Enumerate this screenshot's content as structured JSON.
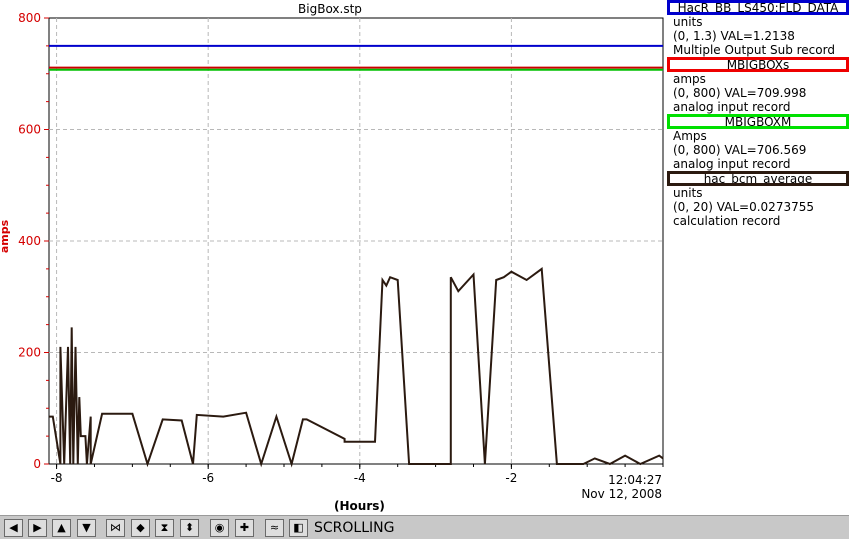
{
  "window": {
    "title": "BigBox.stp"
  },
  "chart_data": {
    "type": "line",
    "title": "BigBox.stp",
    "xlabel": "(Hours)",
    "ylabel": "amps",
    "xlim": [
      -8.1,
      0
    ],
    "ylim": [
      0,
      800
    ],
    "x_ticks": [
      -8,
      -6,
      -4,
      -2
    ],
    "y_ticks": [
      0,
      200,
      400,
      600,
      800
    ],
    "grid": true,
    "series": [
      {
        "name": "HacR_BB_LS450:FLD_DATA",
        "color": "#0000cc",
        "x": [
          -8.1,
          0
        ],
        "values": [
          750,
          750
        ]
      },
      {
        "name": "MBIGBOXs",
        "color": "#cc0000",
        "x": [
          -8.1,
          0
        ],
        "values": [
          711,
          711
        ]
      },
      {
        "name": "MBIGBOXM",
        "color": "#00c000",
        "x": [
          -8.1,
          0
        ],
        "values": [
          707,
          707
        ]
      },
      {
        "name": "hac_bcm_average",
        "color": "#2b1a10",
        "x": [
          -8.1,
          -8.05,
          -7.95,
          -7.95,
          -7.9,
          -7.85,
          -7.82,
          -7.8,
          -7.78,
          -7.75,
          -7.72,
          -7.7,
          -7.68,
          -7.62,
          -7.6,
          -7.55,
          -7.55,
          -7.4,
          -7.4,
          -7.0,
          -6.8,
          -6.6,
          -6.35,
          -6.2,
          -6.2,
          -6.15,
          -5.8,
          -5.5,
          -5.3,
          -5.1,
          -4.9,
          -4.75,
          -4.7,
          -4.2,
          -4.2,
          -3.8,
          -3.7,
          -3.65,
          -3.6,
          -3.5,
          -3.35,
          -3.25,
          -2.8,
          -2.8,
          -2.7,
          -2.5,
          -2.35,
          -2.2,
          -2.1,
          -2.0,
          -1.8,
          -1.6,
          -1.4,
          -1.05,
          -0.9,
          -0.7,
          -0.5,
          -0.3,
          -0.05,
          0
        ],
        "values": [
          85,
          85,
          0,
          210,
          0,
          210,
          0,
          245,
          0,
          210,
          0,
          120,
          50,
          50,
          0,
          85,
          0,
          90,
          90,
          90,
          0,
          80,
          78,
          0,
          0,
          88,
          85,
          92,
          0,
          85,
          0,
          80,
          80,
          45,
          40,
          40,
          330,
          320,
          335,
          330,
          0,
          0,
          0,
          335,
          310,
          340,
          0,
          330,
          335,
          345,
          330,
          350,
          0,
          0,
          10,
          0,
          15,
          0,
          15,
          10
        ]
      }
    ],
    "timestamp": {
      "time": "12:04:27",
      "date": "Nov 12, 2008"
    }
  },
  "legend": [
    {
      "name": "HacR_BB_LS450:FLD_DATA",
      "color": "#0000cc",
      "units": "units",
      "range_value": "(0, 1.3) VAL=1.2138",
      "record_type": "Multiple Output Sub record"
    },
    {
      "name": "MBIGBOXs",
      "color": "#ee0000",
      "units": "amps",
      "range_value": "(0, 800) VAL=709.998",
      "record_type": "analog input record"
    },
    {
      "name": "MBIGBOXM",
      "color": "#00e000",
      "units": "Amps",
      "range_value": "(0, 800) VAL=706.569",
      "record_type": "analog input record"
    },
    {
      "name": "hac_bcm_average",
      "color": "#2b1a10",
      "units": "units",
      "range_value": "(0, 20) VAL=0.0273755",
      "record_type": "calculation record"
    }
  ],
  "toolbar": {
    "buttons": [
      {
        "name": "pan-left-icon",
        "glyph": "◀"
      },
      {
        "name": "pan-right-icon",
        "glyph": "▶"
      },
      {
        "name": "pan-up-icon",
        "glyph": "▲"
      },
      {
        "name": "pan-down-icon",
        "glyph": "▼"
      },
      {
        "name": "zoom-in-horizontal-icon",
        "glyph": "⋈"
      },
      {
        "name": "zoom-out-horizontal-icon",
        "glyph": "◆"
      },
      {
        "name": "zoom-in-vertical-icon",
        "glyph": "⧗"
      },
      {
        "name": "zoom-out-vertical-icon",
        "glyph": "⬍"
      },
      {
        "name": "zoom-reset-icon",
        "glyph": "◉"
      },
      {
        "name": "zoom-add-icon",
        "glyph": "✚"
      },
      {
        "name": "scrolling-toggle-icon",
        "glyph": "≈"
      },
      {
        "name": "step-icon",
        "glyph": "◧"
      }
    ],
    "mode_label": "SCROLLING"
  }
}
